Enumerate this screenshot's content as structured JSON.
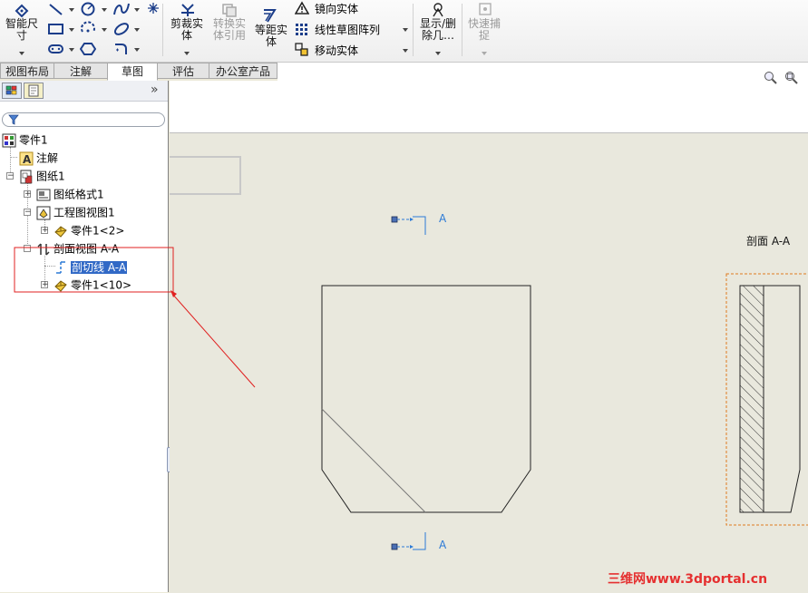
{
  "ribbon": {
    "smart_dim": [
      "智能尺",
      "寸"
    ],
    "trim": [
      "剪裁实",
      "体"
    ],
    "convert": [
      "转换实",
      "体引用"
    ],
    "offset": [
      "等距实",
      "体"
    ],
    "mirror": "镜向实体",
    "linear_pattern": "线性草图阵列",
    "move": "移动实体",
    "show_delete": [
      "显示/删",
      "除几…"
    ],
    "quick_snap": [
      "快速捕",
      "捉"
    ]
  },
  "tabs": [
    {
      "label": "视图布局",
      "active": false
    },
    {
      "label": "注解",
      "active": false
    },
    {
      "label": "草图",
      "active": true
    },
    {
      "label": "评估",
      "active": false
    },
    {
      "label": "办公室产品",
      "active": false
    }
  ],
  "tree": {
    "root": "零件1",
    "annotations": "注解",
    "sheet": "图纸1",
    "sheet_format": "图纸格式1",
    "drawing_view": "工程图视图1",
    "part_ref1": "零件1<2>",
    "section_view": "剖面视图 A-A",
    "section_line": "剖切线 A-A",
    "part_ref2": "零件1<10>"
  },
  "drawing": {
    "section_label_top": "A",
    "section_label_bottom": "A",
    "section_view_title": "剖面 A-A"
  },
  "watermark": "三维网www.3dportal.cn",
  "colors": {
    "selection": "#3169c6",
    "annotation_arrow": "#e02020",
    "section_line": "#2c7ad6",
    "sheet_bg": "#e9e8dd"
  }
}
